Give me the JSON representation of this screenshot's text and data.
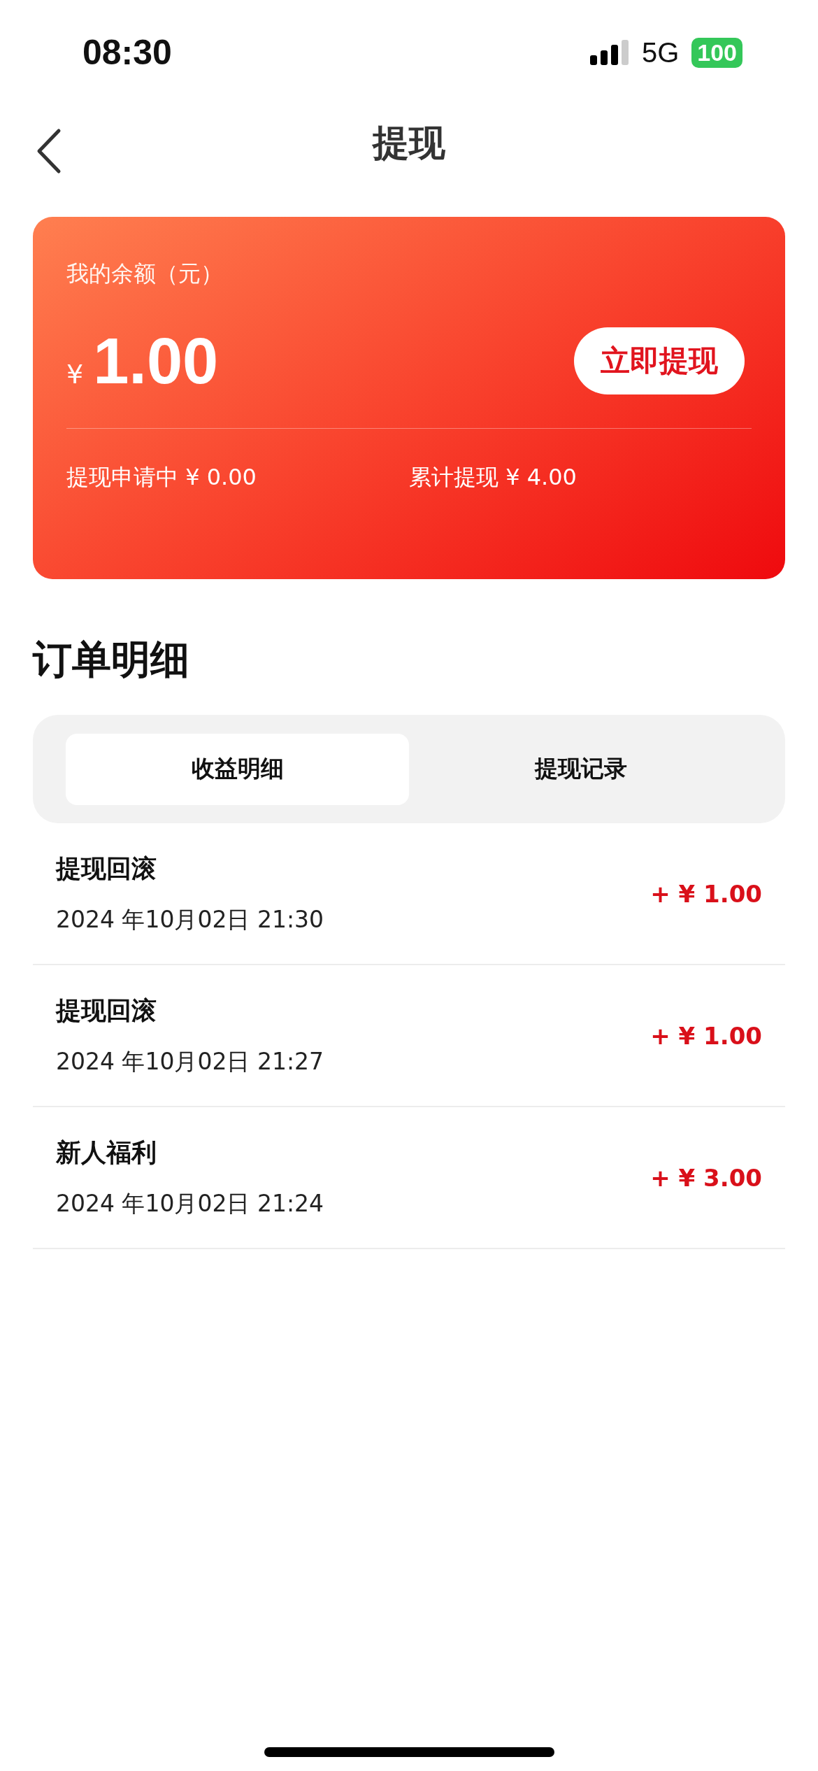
{
  "status_bar": {
    "time": "08:30",
    "network": "5G",
    "battery": "100"
  },
  "nav": {
    "title": "提现"
  },
  "balance_card": {
    "label": "我的余额（元）",
    "currency": "¥",
    "amount": "1.00",
    "button": "立即提现",
    "pending": "提现申请中 ¥ 0.00",
    "total": "累计提现 ¥ 4.00"
  },
  "section_title": "订单明细",
  "tabs": [
    {
      "label": "收益明细",
      "selected": true
    },
    {
      "label": "提现记录",
      "selected": false
    }
  ],
  "records": [
    {
      "title": "提现回滚",
      "time": "2024 年10月02日 21:30",
      "amount": "+ ¥ 1.00"
    },
    {
      "title": "提现回滚",
      "time": "2024 年10月02日 21:27",
      "amount": "+ ¥ 1.00"
    },
    {
      "title": "新人福利",
      "time": "2024 年10月02日 21:24",
      "amount": "+ ¥ 3.00"
    }
  ]
}
